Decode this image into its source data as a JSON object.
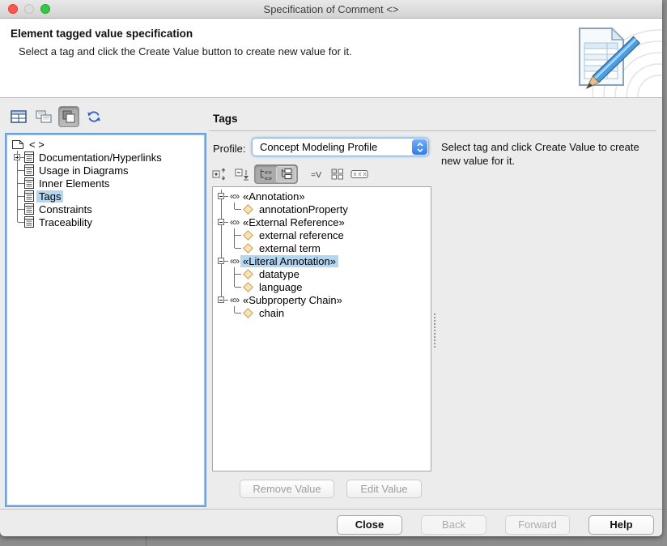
{
  "window_title": "Specification of Comment <>",
  "traffic_lights": [
    "close",
    "minimize",
    "zoom"
  ],
  "header": {
    "title": "Element tagged value specification",
    "subtitle": "Select a tag and click the Create Value button to create new value for it.",
    "icon": "document-with-pencil-icon"
  },
  "left_panel": {
    "toolbar_icons": [
      "properties-view-icon",
      "structure-view-icon",
      "windows-view-icon",
      "refresh-icon"
    ],
    "tree": {
      "root_label": "< >",
      "root_icon": "comment-page-icon",
      "items": [
        {
          "label": "Documentation/Hyperlinks",
          "expander": "plus"
        },
        {
          "label": "Usage in Diagrams"
        },
        {
          "label": "Inner Elements"
        },
        {
          "label": "Tags",
          "selected": true
        },
        {
          "label": "Constraints"
        },
        {
          "label": "Traceability",
          "last": true
        }
      ]
    }
  },
  "tags_panel": {
    "heading": "Tags",
    "profile_label": "Profile:",
    "profile_value": "Concept Modeling Profile",
    "helper_text": "Select tag and click Create Value to create new value for it.",
    "toolbar_icons": [
      "expand-node-icon",
      "collapse-node-icon",
      "tree-stereotypes-toggle",
      "tree-plain-toggle",
      "show-values-icon",
      "grid-view-icon",
      "slot-view-icon"
    ],
    "tree": [
      {
        "label": "«Annotation»",
        "children": [
          "annotationProperty"
        ]
      },
      {
        "label": "«External Reference»",
        "children": [
          "external reference",
          "external term"
        ]
      },
      {
        "label": "«Literal Annotation»",
        "selected": true,
        "children": [
          "datatype",
          "language"
        ]
      },
      {
        "label": "«Subproperty Chain»",
        "children": [
          "chain"
        ]
      }
    ],
    "remove_button": "Remove Value",
    "edit_button": "Edit Value"
  },
  "footer": {
    "close": "Close",
    "back": "Back",
    "forward": "Forward",
    "help": "Help"
  },
  "colors": {
    "selection": "#b3d7f3",
    "focus_ring": "#6ca2e0",
    "accent_blue": "#3b82ec",
    "window_bg": "#ececec"
  }
}
